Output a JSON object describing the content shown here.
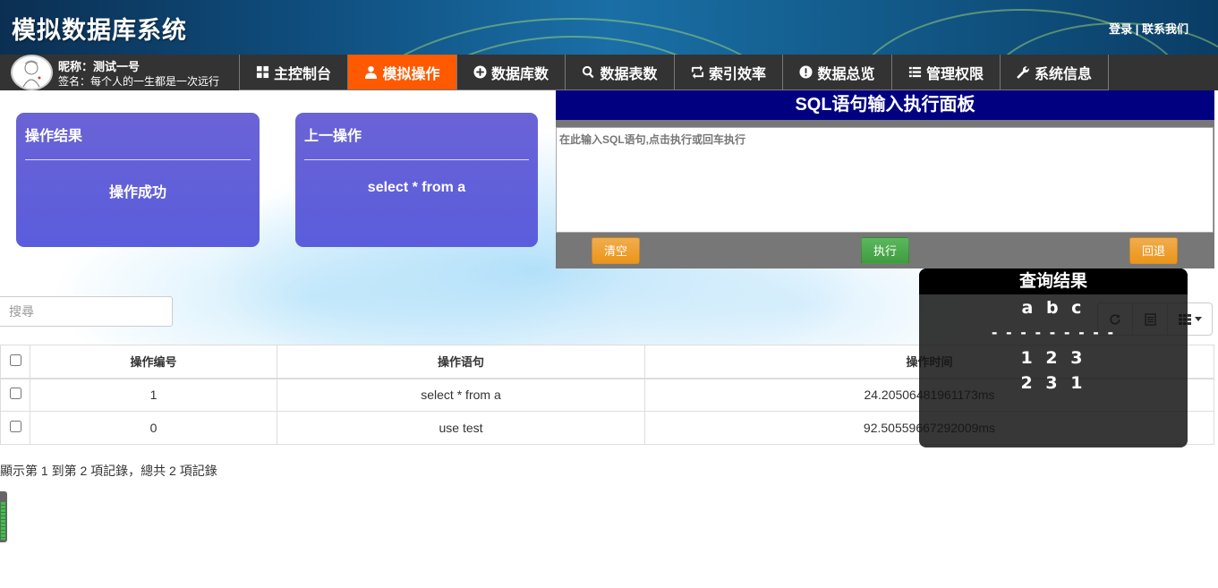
{
  "header": {
    "app_title": "模拟数据库系统",
    "login": "登录",
    "separator": " | ",
    "contact": "联系我们"
  },
  "user": {
    "nickname": "昵称：测试一号",
    "signature": "签名：每个人的一生都是一次远行"
  },
  "nav": {
    "tabs": [
      {
        "label": "主控制台",
        "icon": "dashboard-icon"
      },
      {
        "label": "模拟操作",
        "icon": "user-icon",
        "active": true
      },
      {
        "label": "数据库数",
        "icon": "plus-circle-icon"
      },
      {
        "label": "数据表数",
        "icon": "search-icon"
      },
      {
        "label": "索引效率",
        "icon": "retweet-icon"
      },
      {
        "label": "数据总览",
        "icon": "exclamation-circle-icon"
      },
      {
        "label": "管理权限",
        "icon": "list-icon"
      },
      {
        "label": "系统信息",
        "icon": "wrench-icon"
      }
    ],
    "active_color": "#ff5a00"
  },
  "cards": {
    "result": {
      "title": "操作结果",
      "value": "操作成功"
    },
    "last_op": {
      "title": "上一操作",
      "value": "select * from a"
    }
  },
  "sql_panel": {
    "title": "SQL语句输入执行面板",
    "placeholder": "在此输入SQL语句,点击执行或回车执行",
    "clear_label": "清空",
    "execute_label": "执行",
    "rollback_label": "回退"
  },
  "table": {
    "search_placeholder": "搜尋",
    "columns": [
      "操作编号",
      "操作语句",
      "操作时间"
    ],
    "rows": [
      {
        "id": "1",
        "statement": "select * from a",
        "time": "24.20506481961173ms"
      },
      {
        "id": "0",
        "statement": "use test",
        "time": "92.50559667292009ms"
      }
    ],
    "pagination_info": "顯示第 1 到第 2 項記錄，總共 2 項記錄"
  },
  "query_result": {
    "title": "查询结果",
    "header_line": "a b c",
    "divider": "- - - - - - - - -",
    "lines": [
      "1 2 3",
      "2 3 1"
    ]
  },
  "colors": {
    "card_bg": "#5f60da",
    "sql_header": "#000080",
    "warning": "#f0ad4e",
    "success": "#5cb85c"
  }
}
